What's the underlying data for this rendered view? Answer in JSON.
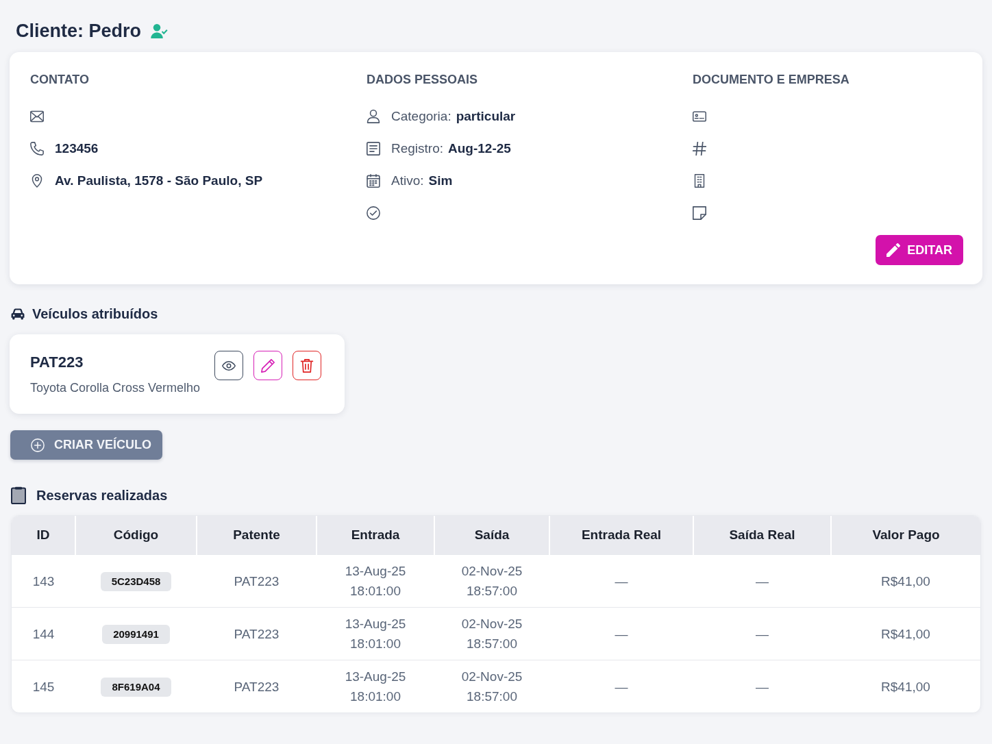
{
  "header": {
    "title": "Cliente: Pedro"
  },
  "info_card": {
    "sections": [
      {
        "heading": "CONTATO",
        "items": [
          {
            "kind": "email"
          },
          {
            "kind": "phone",
            "value": "123456"
          },
          {
            "kind": "address",
            "value": "Av. Paulista, 1578 - São Paulo, SP"
          }
        ]
      },
      {
        "heading": "DADOS PESSOAIS",
        "items": [
          {
            "kind": "category",
            "label": "Categoria:",
            "value": "particular"
          },
          {
            "kind": "registration",
            "label": "Registro:",
            "value": "Aug-12-25"
          },
          {
            "kind": "active",
            "label": "Ativo:",
            "value": "Sim"
          },
          {
            "kind": "status"
          }
        ]
      },
      {
        "heading": "DOCUMENTO E EMPRESA",
        "items": [
          {
            "kind": "document"
          },
          {
            "kind": "number"
          },
          {
            "kind": "company"
          },
          {
            "kind": "notes"
          }
        ]
      }
    ],
    "edit_button": "EDITAR"
  },
  "vehicles": {
    "title": "Veículos atribuídos",
    "items": [
      {
        "plate": "PAT223",
        "description": "Toyota Corolla Cross Vermelho"
      }
    ],
    "create_button": "CRIAR VEÍCULO"
  },
  "reservations": {
    "title": "Reservas realizadas",
    "table": {
      "columns": [
        "ID",
        "Código",
        "Patente",
        "Entrada",
        "Saída",
        "Entrada Real",
        "Saída Real",
        "Valor Pago"
      ],
      "rows": [
        {
          "id": "143",
          "code": "5C23D458",
          "plate": "PAT223",
          "entry_date": "13-Aug-25",
          "entry_time": "18:01:00",
          "exit_date": "02-Nov-25",
          "exit_time": "18:57:00",
          "actual_entry": "—",
          "actual_exit": "—",
          "amount": "R$41,00"
        },
        {
          "id": "144",
          "code": "20991491",
          "plate": "PAT223",
          "entry_date": "13-Aug-25",
          "entry_time": "18:01:00",
          "exit_date": "02-Nov-25",
          "exit_time": "18:57:00",
          "actual_entry": "—",
          "actual_exit": "—",
          "amount": "R$41,00"
        },
        {
          "id": "145",
          "code": "8F619A04",
          "plate": "PAT223",
          "entry_date": "13-Aug-25",
          "entry_time": "18:01:00",
          "exit_date": "02-Nov-25",
          "exit_time": "18:57:00",
          "actual_entry": "—",
          "actual_exit": "—",
          "amount": "R$41,00"
        }
      ]
    }
  }
}
